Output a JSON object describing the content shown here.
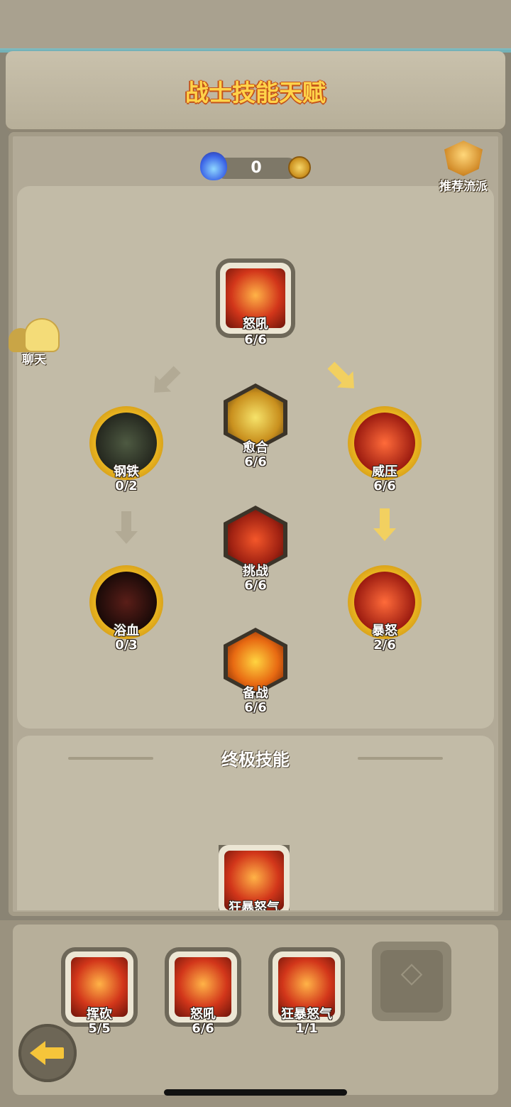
{
  "header": {
    "title": "战士技能天赋"
  },
  "currency": {
    "value": "0",
    "icon": "blue-flame-icon",
    "coin_icon": "gold-coin-icon"
  },
  "recommend": {
    "label": "推荐流派",
    "icon": "fist-badge-icon"
  },
  "chat": {
    "label": "聊天",
    "icon": "ghost-chat-icon"
  },
  "tree": {
    "nuhou": {
      "name": "怒吼",
      "level": "6/6"
    },
    "yuhe": {
      "name": "愈合",
      "level": "6/6"
    },
    "gangtie": {
      "name": "钢铁",
      "level": "0/2"
    },
    "weiya": {
      "name": "威压",
      "level": "6/6"
    },
    "tiaozhan": {
      "name": "挑战",
      "level": "6/6"
    },
    "yuxue": {
      "name": "浴血",
      "level": "0/3"
    },
    "baonu": {
      "name": "暴怒",
      "level": "2/6"
    },
    "beizhan": {
      "name": "备战",
      "level": "6/6"
    }
  },
  "ultimate": {
    "section_title": "终极技能",
    "skill": {
      "name": "狂暴怒气"
    }
  },
  "equipped": [
    {
      "name": "挥砍",
      "level": "5/5"
    },
    {
      "name": "怒吼",
      "level": "6/6"
    },
    {
      "name": "狂暴怒气",
      "level": "1/1"
    }
  ],
  "colors": {
    "title_gold": "#ffd34a",
    "arrow_active": "#f2d060",
    "panel": "#c2bba7"
  }
}
